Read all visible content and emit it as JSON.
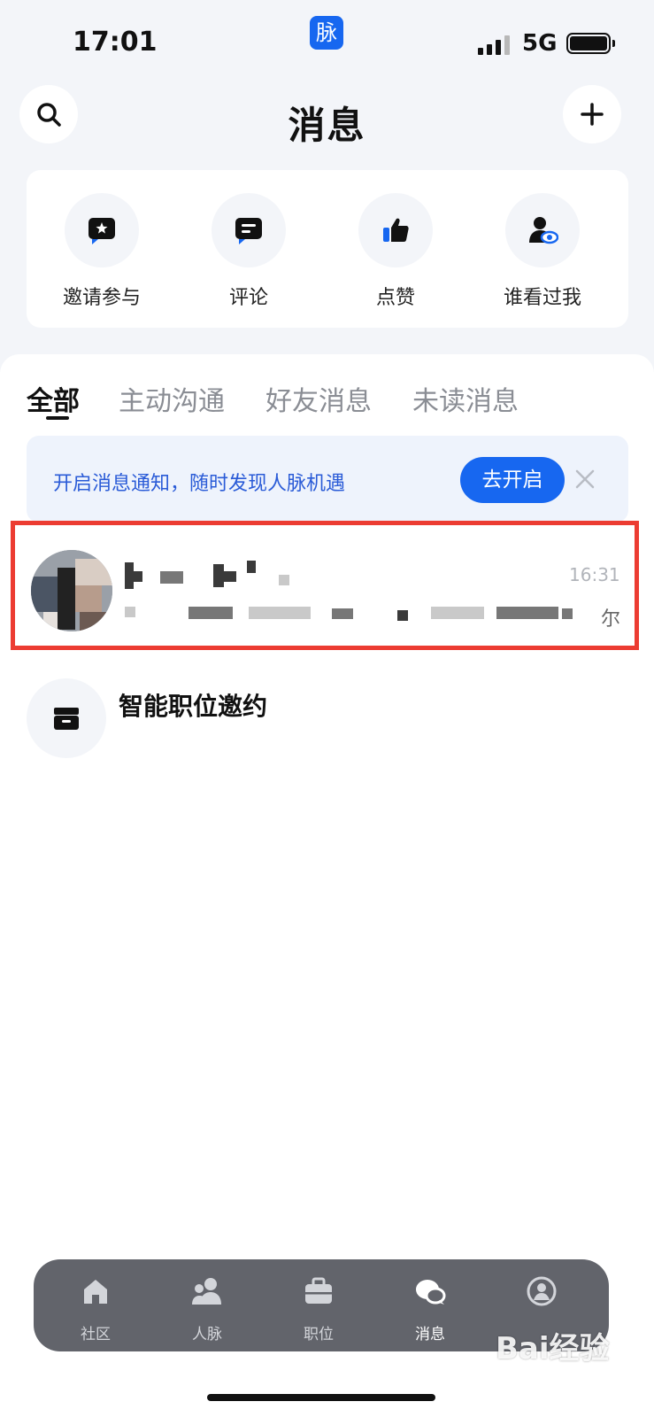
{
  "status_bar": {
    "time": "17:01",
    "app_badge": "脉",
    "network": "5G"
  },
  "header": {
    "title": "消息",
    "search_icon": "search-icon",
    "add_icon": "plus-icon"
  },
  "shortcuts": [
    {
      "label": "邀请参与",
      "icon": "invite-star-chat-icon"
    },
    {
      "label": "评论",
      "icon": "comment-bubble-icon"
    },
    {
      "label": "点赞",
      "icon": "thumbs-up-icon"
    },
    {
      "label": "谁看过我",
      "icon": "viewer-eye-icon"
    }
  ],
  "tabs": [
    {
      "label": "全部",
      "active": true
    },
    {
      "label": "主动沟通",
      "active": false
    },
    {
      "label": "好友消息",
      "active": false
    },
    {
      "label": "未读消息",
      "active": false
    }
  ],
  "notice": {
    "text": "开启消息通知，随时发现人脉机遇",
    "button": "去开启"
  },
  "chat": {
    "time": "16:31",
    "tail": "尔"
  },
  "smart_job": {
    "title": "智能职位邀约"
  },
  "bottom_nav": [
    {
      "label": "社区",
      "icon": "home-icon"
    },
    {
      "label": "人脉",
      "icon": "contacts-icon"
    },
    {
      "label": "职位",
      "icon": "briefcase-icon"
    },
    {
      "label": "消息",
      "icon": "message-bubble-icon",
      "active": true
    },
    {
      "label": "",
      "icon": "profile-icon"
    }
  ],
  "watermark": "Bai经验",
  "colors": {
    "accent": "#1767f0",
    "highlight_border": "#ec3c32",
    "background": "#f3f5f9"
  }
}
